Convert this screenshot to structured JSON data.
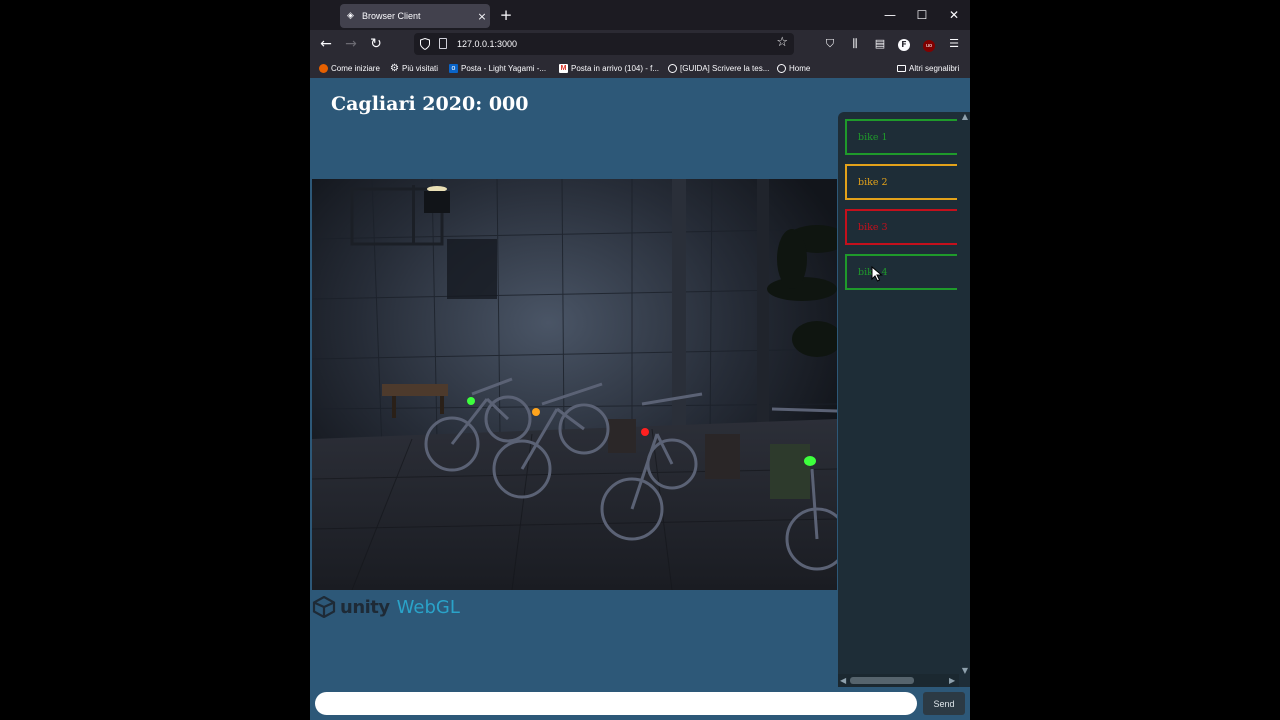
{
  "window": {
    "tab_title": "Browser Client",
    "tab_close": "×",
    "new_tab": "+",
    "minimize": "—",
    "maximize": "☐",
    "close": "✕"
  },
  "nav": {
    "back": "←",
    "forward": "→",
    "reload": "↻",
    "url": "127.0.0.1:3000",
    "bookmark_star": "☆"
  },
  "toolbar_icons": [
    "pocket-icon",
    "library-icon",
    "sidebar-icon",
    "firefox-account-icon",
    "ublock-icon",
    "menu-icon"
  ],
  "bookmarks": [
    {
      "label": "Come iniziare",
      "icon": "firefox-icon"
    },
    {
      "label": "Più visitati",
      "icon": "gear-icon"
    },
    {
      "label": "Posta - Light Yagami -...",
      "icon": "outlook-icon"
    },
    {
      "label": "Posta in arrivo (104) - f...",
      "icon": "gmail-icon"
    },
    {
      "label": "[GUIDA] Scrivere la tes...",
      "icon": "globe-icon"
    },
    {
      "label": "Home",
      "icon": "globe-icon"
    }
  ],
  "other_bookmarks": "Altri segnalibri",
  "page": {
    "title": "Cagliari 2020: 000",
    "logo_unity": "unity",
    "logo_webgl": "WebGL"
  },
  "bikes": [
    {
      "label": "bike 1",
      "color": "#1f9a2b"
    },
    {
      "label": "bike 2",
      "color": "#e3a21a"
    },
    {
      "label": "bike 3",
      "color": "#c4101c"
    },
    {
      "label": "bike 4",
      "color": "#1f9a2b"
    }
  ],
  "message": {
    "placeholder": "",
    "send_label": "Send"
  },
  "colors": {
    "page_bg": "#2d5878",
    "sidebar_bg": "#1e2d37",
    "status_green": "#1f9a2b",
    "status_orange": "#e3a21a",
    "status_red": "#c4101c"
  }
}
